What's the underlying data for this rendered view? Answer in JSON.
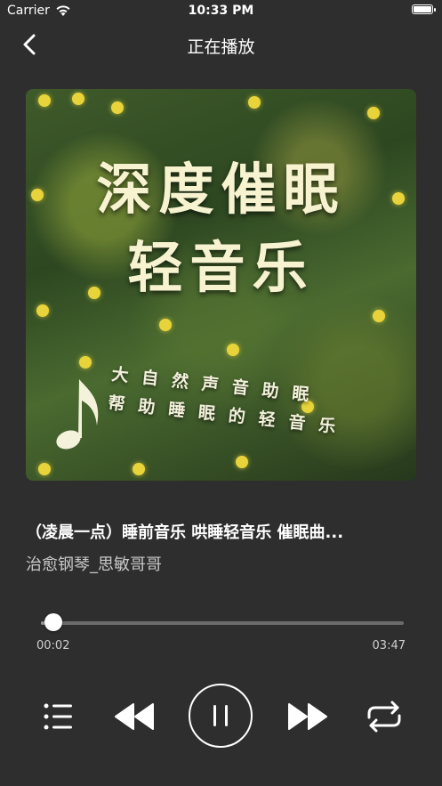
{
  "status_bar": {
    "carrier": "Carrier",
    "time": "10:33 PM"
  },
  "nav": {
    "title": "正在播放"
  },
  "cover": {
    "title_line1": "深度催眠",
    "title_line2": "轻音乐",
    "subtitle_line1": "大自然声音助眠",
    "subtitle_line2": "帮助睡眠的轻音乐"
  },
  "track": {
    "title": "（凌晨一点）睡前音乐 哄睡轻音乐 催眠曲...",
    "artist": "治愈钢琴_思敏哥哥"
  },
  "progress": {
    "current": "00:02",
    "total": "03:47",
    "fraction": 0.009
  },
  "controls": {
    "icons": [
      "playlist-icon",
      "previous-icon",
      "pause-icon",
      "next-icon",
      "repeat-icon"
    ]
  },
  "colors": {
    "background": "#2e2e2e",
    "text": "#ffffff",
    "secondary_text": "#c9c9c9",
    "track": "#6b6b6b"
  }
}
